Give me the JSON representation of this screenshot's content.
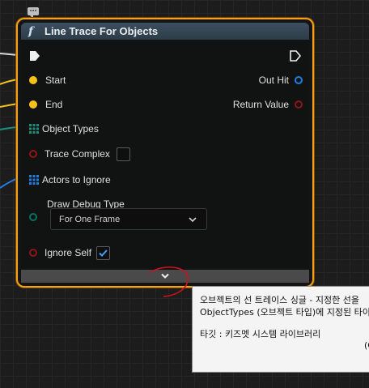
{
  "node": {
    "title": "Line Trace For Objects",
    "function_icon": "f",
    "inputs": [
      {
        "label": "Start"
      },
      {
        "label": "End"
      },
      {
        "label": "Object Types"
      },
      {
        "label": "Trace Complex"
      },
      {
        "label": "Actors to Ignore"
      },
      {
        "label": "Draw Debug Type"
      },
      {
        "label": "Ignore Self"
      }
    ],
    "outputs": [
      {
        "label": "Out Hit"
      },
      {
        "label": "Return Value"
      }
    ],
    "draw_debug_type_value": "For One Frame",
    "trace_complex_checked": false,
    "ignore_self_checked": true
  },
  "tooltip": {
    "line1": "오브젝트의 선 트레이스 싱글 - 지정한 선을",
    "line2": "ObjectTypes (오브젝트 타입)에 지정된 타이",
    "line3": "타깃 : 키즈멧 시스템 라이브러리",
    "line4": "(C"
  },
  "colors": {
    "node_border": "#f3a11b",
    "header": "#3c4f5f",
    "vector_pin": "#f6c21a",
    "struct_pin": "#1f7fe0",
    "bool_pin": "#8e1616",
    "object_pin": "#1b8e7e",
    "enum_pin": "#06735e"
  }
}
